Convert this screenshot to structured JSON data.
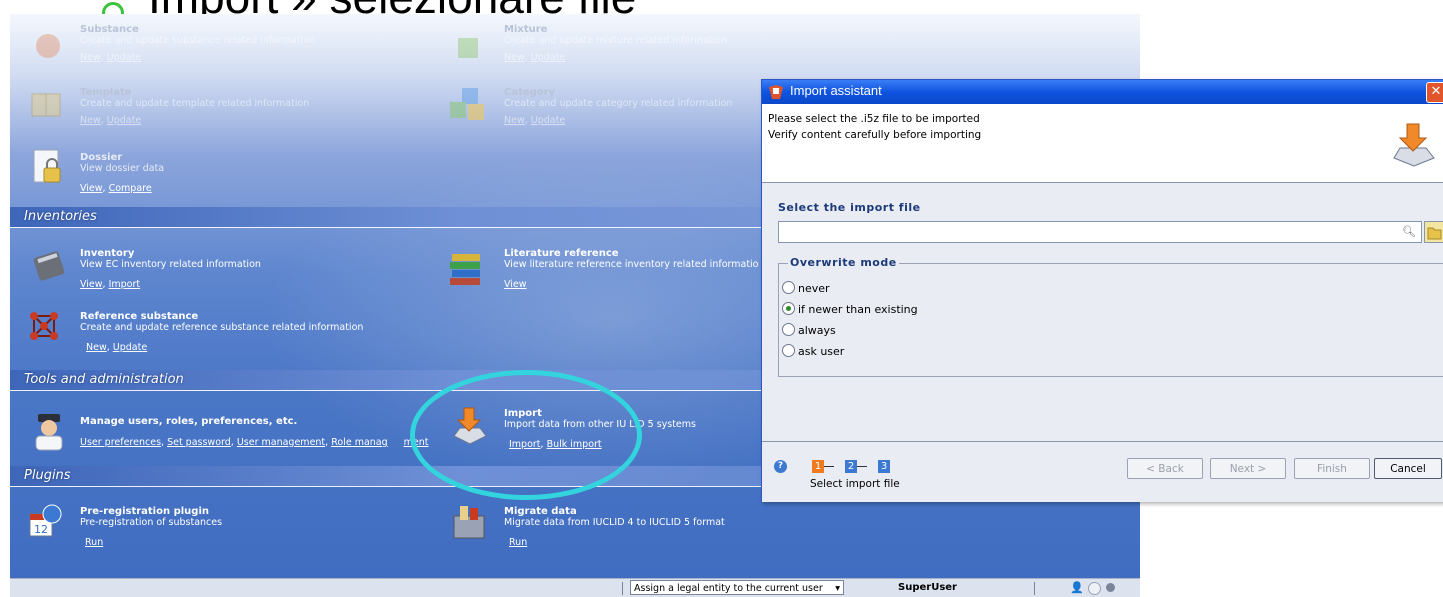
{
  "slide": {
    "title": "Import » selezionare file"
  },
  "colors": {
    "accent": "#33d4dd",
    "titlebar": "#0f54e0",
    "bullet": "#3cc33c"
  },
  "app": {
    "faded_items": [
      {
        "title": "Substance",
        "desc": "Create and update substance related information",
        "links": [
          "New",
          "Update"
        ],
        "icon": "substance-icon"
      },
      {
        "title": "Mixture",
        "desc": "Create and update mixture related information",
        "links": [
          "New",
          "Update"
        ],
        "icon": "mixture-icon"
      },
      {
        "title": "Template",
        "desc": "Create and update template related information",
        "links": [
          "New",
          "Update"
        ],
        "icon": "template-icon"
      },
      {
        "title": "Category",
        "desc": "Create and update category related information",
        "links": [
          "New",
          "Update"
        ],
        "icon": "category-icon"
      }
    ],
    "dossier": {
      "title": "Dossier",
      "desc": "View dossier data",
      "links": [
        "View",
        "Compare"
      ]
    },
    "sections": {
      "inventories": "Inventories",
      "tools": "Tools and administration",
      "plugins": "Plugins"
    },
    "inventory": {
      "title": "Inventory",
      "desc": "View EC inventory related information",
      "links": [
        "View",
        "Import"
      ]
    },
    "literature": {
      "title": "Literature reference",
      "desc": "View literature reference inventory related informatio",
      "links": [
        "View"
      ]
    },
    "reference": {
      "title": "Reference substance",
      "desc": "Create and update reference substance related information",
      "links": [
        "New",
        "Update"
      ]
    },
    "manage": {
      "title": "Manage users, roles, preferences, etc.",
      "links": [
        "User preferences",
        "Set password",
        "User management",
        "Role manag"
      ],
      "link_tail": "ment"
    },
    "import": {
      "title": "Import",
      "desc": "Import data from other IU  LID 5 systems",
      "links": [
        "Import",
        "Bulk import"
      ]
    },
    "prereg": {
      "title": "Pre-registration plugin",
      "desc": "Pre-registration of substances",
      "links": [
        "Run"
      ]
    },
    "migrate": {
      "title": "Migrate data",
      "desc": "Migrate data from IUCLID 4 to IUCLID 5 format",
      "links": [
        "Run"
      ]
    },
    "status": {
      "legal_entity": "Assign a legal entity to the current user",
      "user": "SuperUser"
    }
  },
  "dialog": {
    "title": "Import assistant",
    "header_line1": "Please select the .i5z file to be imported",
    "header_line2": "Verify content carefully before importing",
    "select_label": "Select the import file",
    "file_value": "",
    "overwrite_legend": "Overwrite mode",
    "options": [
      "never",
      "if newer than existing",
      "always",
      "ask user"
    ],
    "selected_option": "if newer than existing",
    "steps": [
      "1",
      "2",
      "3"
    ],
    "step_label": "Select import file",
    "buttons": {
      "back": "< Back",
      "next": "Next >",
      "finish": "Finish",
      "cancel": "Cancel"
    }
  }
}
